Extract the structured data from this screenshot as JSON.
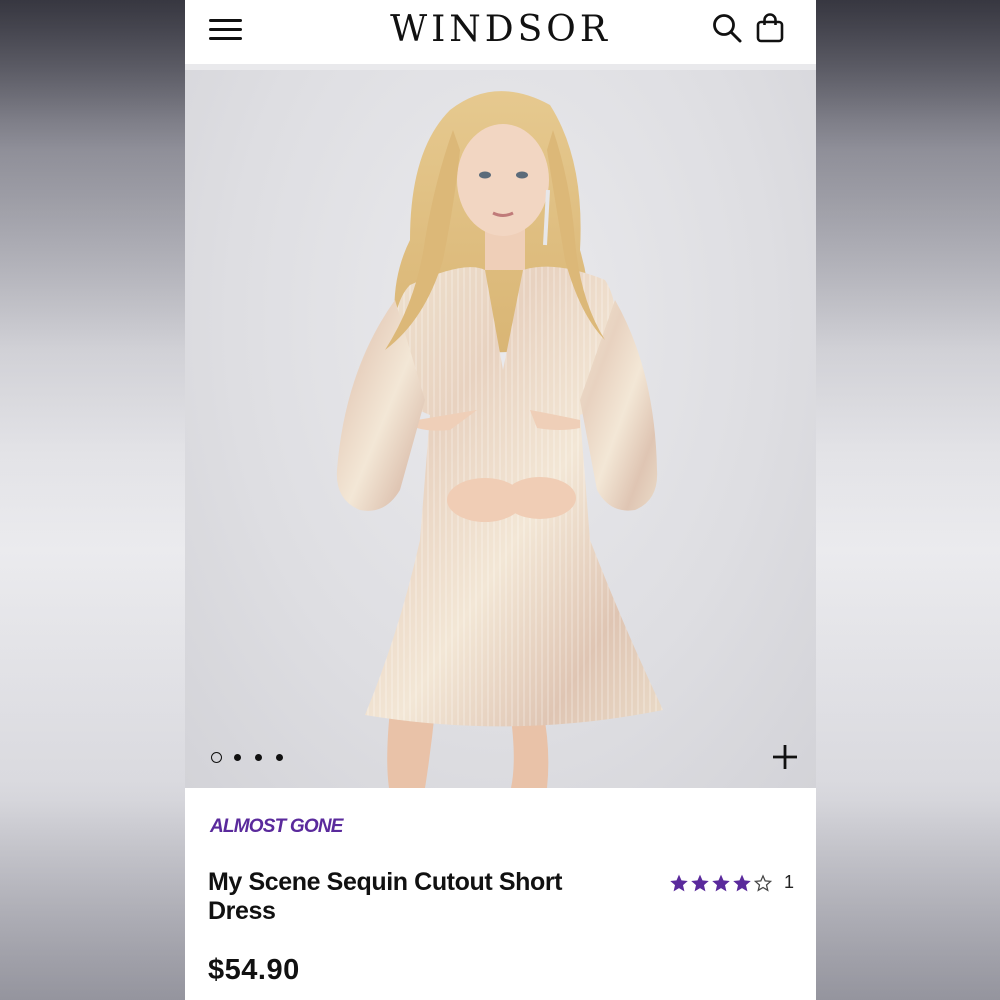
{
  "header": {
    "logo": "WINDSOR",
    "menu_icon": "hamburger-menu-icon",
    "search_icon": "search-icon",
    "bag_icon": "shopping-bag-icon"
  },
  "gallery": {
    "image": "model wearing sequin cutout short dress",
    "slide_count": 4,
    "active_slide": 1,
    "zoom_icon": "plus-icon"
  },
  "product": {
    "badge": "ALMOST GONE",
    "title": "My Scene Sequin Cutout Short Dress",
    "rating": 4,
    "rating_max": 5,
    "review_count": "1",
    "price": "$54.90"
  },
  "colors": {
    "badge": "#5a2a9c",
    "star": "#5a2a9c"
  }
}
